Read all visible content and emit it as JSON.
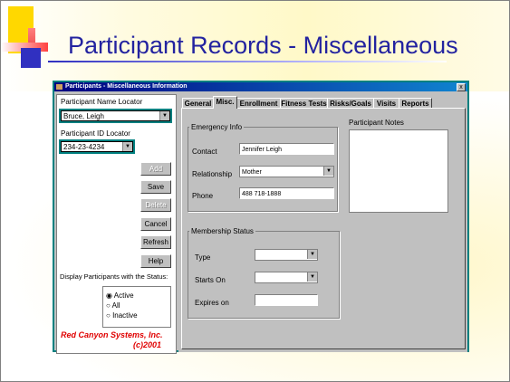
{
  "slide": {
    "title": "Participant Records - Miscellaneous"
  },
  "window": {
    "title": "Participants - Miscellaneous Information",
    "close_label": "x"
  },
  "left": {
    "name_locator_label": "Participant Name Locator",
    "name_locator_value": "Bruce, Leigh",
    "id_locator_label": "Participant ID Locator",
    "id_locator_value": "234-23-4234",
    "buttons": {
      "add": "Add",
      "save": "Save",
      "delete": "Delete",
      "cancel": "Cancel",
      "refresh": "Refresh",
      "help": "Help"
    },
    "status_label": "Display Participants with the Status:",
    "status_options": [
      "Active",
      "All",
      "Inactive"
    ],
    "status_selected": "Active",
    "brand_line1": "Red Canyon Systems, Inc.",
    "brand_line2": "(c)2001"
  },
  "tabs": [
    "General",
    "Misc.",
    "Enrollment",
    "Fitness Tests",
    "Risks/Goals",
    "Visits",
    "Reports"
  ],
  "active_tab": "Misc.",
  "misc": {
    "emergency_title": "Emergency Info",
    "contact_label": "Contact",
    "contact_value": "Jennifer Leigh",
    "relationship_label": "Relationship",
    "relationship_value": "Mother",
    "phone_label": "Phone",
    "phone_value": "488 718-1888",
    "membership_title": "Membership Status",
    "type_label": "Type",
    "type_value": "",
    "starts_label": "Starts On",
    "starts_value": "",
    "expires_label": "Expires on",
    "expires_value": "",
    "notes_label": "Participant Notes"
  },
  "colors": {
    "title_blue": "#2323a0",
    "brand_red": "#e00000",
    "window_teal": "#008080"
  }
}
